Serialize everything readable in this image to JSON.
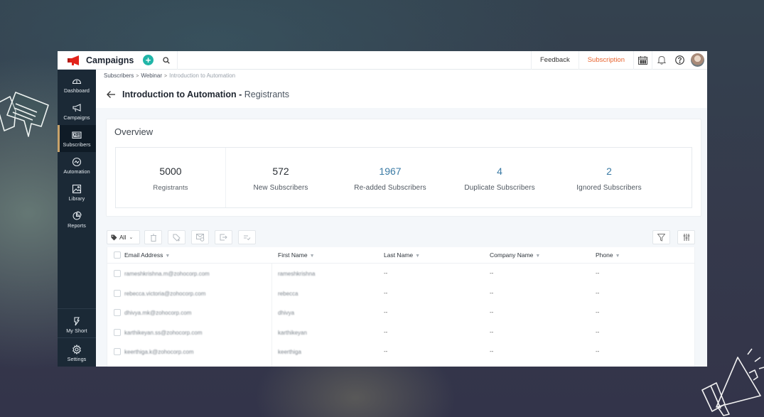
{
  "app": {
    "name": "Campaigns",
    "brand_color": "#e2231a",
    "accent_color": "#20b5a8"
  },
  "topbar": {
    "create_icon": "plus-circle-icon",
    "search_icon": "search-icon",
    "feedback_label": "Feedback",
    "subscription_label": "Subscription",
    "subscription_color": "#e8632e",
    "icons": [
      "calendar-icon",
      "bell-icon",
      "help-icon",
      "avatar"
    ]
  },
  "sidebar": {
    "items": [
      {
        "label": "Dashboard",
        "icon": "gauge-icon"
      },
      {
        "label": "Campaigns",
        "icon": "megaphone-icon"
      },
      {
        "label": "Subscribers",
        "icon": "contact-card-icon",
        "active": true
      },
      {
        "label": "Automation",
        "icon": "automation-icon"
      },
      {
        "label": "Library",
        "icon": "image-library-icon"
      },
      {
        "label": "Reports",
        "icon": "pie-chart-icon"
      }
    ],
    "bottom_items": [
      {
        "label": "My Short",
        "icon": "shortcut-icon"
      },
      {
        "label": "Settings",
        "icon": "gear-icon"
      }
    ]
  },
  "breadcrumb": {
    "items": [
      "Subscribers",
      "Webinar",
      "Introduction to Automation"
    ],
    "separator": ">"
  },
  "page": {
    "title": "Introduction to Automation - ",
    "subtitle": "Registrants"
  },
  "overview": {
    "title": "Overview",
    "stats": [
      {
        "value": "5000",
        "label": "Registrants"
      },
      {
        "value": "572",
        "label": "New Subscribers"
      },
      {
        "value": "1967",
        "label": "Re-added Subscribers"
      },
      {
        "value": "4",
        "label": "Duplicate Subscribers"
      },
      {
        "value": "2",
        "label": "Ignored Subscribers"
      }
    ]
  },
  "toolbar": {
    "tag_filter": "All",
    "actions": [
      "delete-icon",
      "tag-add-icon",
      "email-verify-icon",
      "export-icon",
      "bulk-edit-icon"
    ],
    "right_actions": [
      "filter-icon",
      "column-settings-icon"
    ]
  },
  "table": {
    "columns": [
      "Email Address",
      "First Name",
      "Last Name",
      "Company Name",
      "Phone"
    ],
    "rows": [
      {
        "email": "rameshkrishna.m@zohocorp.com",
        "first": "rameshkrishna",
        "last": "--",
        "company": "--",
        "phone": "--"
      },
      {
        "email": "rebecca.victoria@zohocorp.com",
        "first": "rebecca",
        "last": "--",
        "company": "--",
        "phone": "--"
      },
      {
        "email": "dhivya.mk@zohocorp.com",
        "first": "dhivya",
        "last": "--",
        "company": "--",
        "phone": "--"
      },
      {
        "email": "karthikeyan.ss@zohocorp.com",
        "first": "karthikeyan",
        "last": "--",
        "company": "--",
        "phone": "--"
      },
      {
        "email": "keerthiga.k@zohocorp.com",
        "first": "keerthiga",
        "last": "--",
        "company": "--",
        "phone": "--"
      }
    ]
  }
}
